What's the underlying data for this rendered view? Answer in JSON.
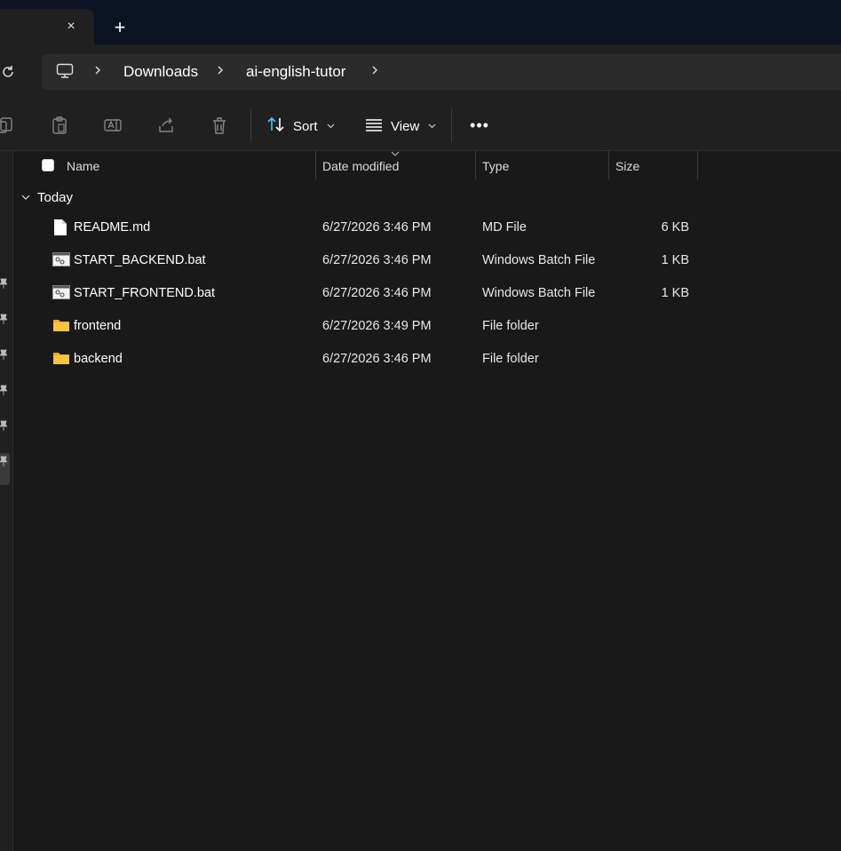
{
  "tabbar": {
    "close_glyph": "×",
    "add_glyph": "+"
  },
  "address": {
    "crumbs": [
      "Downloads",
      "ai-english-tutor"
    ]
  },
  "toolbar": {
    "sort_label": "Sort",
    "view_label": "View",
    "more_glyph": "•••"
  },
  "columns": {
    "name": "Name",
    "date": "Date modified",
    "type": "Type",
    "size": "Size"
  },
  "group": {
    "label": "Today"
  },
  "files": [
    {
      "name": "README.md",
      "date": "6/27/2026 3:46 PM",
      "type": "MD File",
      "size": "6 KB",
      "icon": "document-icon"
    },
    {
      "name": "START_BACKEND.bat",
      "date": "6/27/2026 3:46 PM",
      "type": "Windows Batch File",
      "size": "1 KB",
      "icon": "batch-file-icon"
    },
    {
      "name": "START_FRONTEND.bat",
      "date": "6/27/2026 3:46 PM",
      "type": "Windows Batch File",
      "size": "1 KB",
      "icon": "batch-file-icon"
    },
    {
      "name": "frontend",
      "date": "6/27/2026 3:49 PM",
      "type": "File folder",
      "size": "",
      "icon": "folder-icon"
    },
    {
      "name": "backend",
      "date": "6/27/2026 3:46 PM",
      "type": "File folder",
      "size": "",
      "icon": "folder-icon"
    }
  ],
  "colors": {
    "accent": "#4cc2ff",
    "folder": "#f5c443",
    "background": "#191919"
  }
}
